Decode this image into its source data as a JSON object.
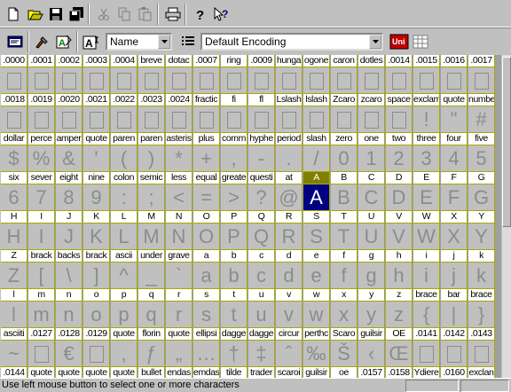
{
  "toolbar": {
    "top_buttons": [
      {
        "name": "new-file-button",
        "icon": "new-document-icon"
      },
      {
        "name": "open-file-button",
        "icon": "open-folder-icon"
      },
      {
        "name": "save-button",
        "icon": "floppy-disk-icon"
      },
      {
        "name": "save-all-button",
        "icon": "multiple-floppy-icon"
      },
      {
        "name": "cut-button",
        "icon": "scissors-icon",
        "disabled": true
      },
      {
        "name": "copy-button",
        "icon": "copy-icon",
        "disabled": true
      },
      {
        "name": "paste-button",
        "icon": "paste-icon",
        "disabled": true
      },
      {
        "name": "print-button",
        "icon": "printer-icon"
      },
      {
        "name": "help-button",
        "icon": "question-mark-icon"
      },
      {
        "name": "context-help-button",
        "icon": "context-help-icon"
      }
    ],
    "view_by_label": "Name",
    "encoding_label": "Default Encoding",
    "unicode_badge": "Uni"
  },
  "grid": {
    "selected": "A",
    "rows": [
      {
        "labels": [
          ".0000",
          ".0001",
          ".0002",
          ".0003",
          ".0004",
          "breve",
          "dotac",
          ".0007",
          "ring",
          ".0009",
          "hunga",
          "ogone",
          "caron",
          "dotles",
          ".0014",
          ".0015",
          ".0016",
          ".0017"
        ],
        "glyphs": [
          "",
          "",
          "",
          "",
          "",
          "",
          "",
          "",
          "",
          "",
          "",
          "",
          "",
          "",
          "",
          "",
          "",
          ""
        ]
      },
      {
        "labels": [
          ".0018",
          ".0019",
          ".0020",
          ".0021",
          ".0022",
          ".0023",
          ".0024",
          "fractic",
          "fi",
          "fl",
          "Lslash",
          "lslash",
          "Zcaro",
          "zcaro",
          "space",
          "exclam",
          "quote",
          "numbe"
        ],
        "glyphs": [
          "",
          "",
          "",
          "",
          "",
          "",
          "",
          "",
          "",
          "",
          "",
          "",
          "",
          "",
          "",
          "!",
          "\"",
          "#"
        ]
      },
      {
        "labels": [
          "dollar",
          "perce",
          "amper",
          "quote",
          "paren",
          "paren",
          "asteris",
          "plus",
          "comm",
          "hyphe",
          "period",
          "slash",
          "zero",
          "one",
          "two",
          "three",
          "four",
          "five"
        ],
        "glyphs": [
          "$",
          "%",
          "&",
          "'",
          "(",
          ")",
          "*",
          "+",
          ",",
          "-",
          ".",
          "/",
          "0",
          "1",
          "2",
          "3",
          "4",
          "5"
        ]
      },
      {
        "labels": [
          "six",
          "sever",
          "eight",
          "nine",
          "colon",
          "semic",
          "less",
          "equal",
          "greate",
          "questi",
          "at",
          "A",
          "B",
          "C",
          "D",
          "E",
          "F",
          "G"
        ],
        "glyphs": [
          "6",
          "7",
          "8",
          "9",
          ":",
          ";",
          "<",
          "=",
          ">",
          "?",
          "@",
          "A",
          "B",
          "C",
          "D",
          "E",
          "F",
          "G"
        ]
      },
      {
        "labels": [
          "H",
          "I",
          "J",
          "K",
          "L",
          "M",
          "N",
          "O",
          "P",
          "Q",
          "R",
          "S",
          "T",
          "U",
          "V",
          "W",
          "X",
          "Y"
        ],
        "glyphs": [
          "H",
          "I",
          "J",
          "K",
          "L",
          "M",
          "N",
          "O",
          "P",
          "Q",
          "R",
          "S",
          "T",
          "U",
          "V",
          "W",
          "X",
          "Y"
        ]
      },
      {
        "labels": [
          "Z",
          "brack",
          "backs",
          "brack",
          "ascii",
          "under",
          "grave",
          "a",
          "b",
          "c",
          "d",
          "e",
          "f",
          "g",
          "h",
          "i",
          "j",
          "k"
        ],
        "glyphs": [
          "Z",
          "[",
          "\\",
          "]",
          "^",
          "_",
          "`",
          "a",
          "b",
          "c",
          "d",
          "e",
          "f",
          "g",
          "h",
          "i",
          "j",
          "k"
        ]
      },
      {
        "labels": [
          "l",
          "m",
          "n",
          "o",
          "p",
          "q",
          "r",
          "s",
          "t",
          "u",
          "v",
          "w",
          "x",
          "y",
          "z",
          "brace",
          "bar",
          "brace"
        ],
        "glyphs": [
          "l",
          "m",
          "n",
          "o",
          "p",
          "q",
          "r",
          "s",
          "t",
          "u",
          "v",
          "w",
          "x",
          "y",
          "z",
          "{",
          "|",
          "}"
        ]
      },
      {
        "labels": [
          "asciiti",
          ".0127",
          ".0128",
          ".0129",
          "quote",
          "florin",
          "quote",
          "ellipsi",
          "dagge",
          "dagge",
          "circur",
          "perthc",
          "Scaro",
          "guilsir",
          "OE",
          ".0141",
          ".0142",
          ".0143"
        ],
        "glyphs": [
          "~",
          "",
          "€",
          "",
          "‚",
          "ƒ",
          "„",
          "…",
          "†",
          "‡",
          "ˆ",
          "‰",
          "Š",
          "‹",
          "Œ",
          "",
          "",
          ""
        ]
      },
      {
        "labels": [
          ".0144",
          "quote",
          "quote",
          "quote",
          "quote",
          "bullet",
          "endas",
          "emdas",
          "tilde",
          "trader",
          "scaroi",
          "guilsir",
          "oe",
          ".0157",
          ".0158",
          "Ydiere",
          ".0160",
          "exclan"
        ],
        "glyphs": [
          "",
          "‘",
          "’",
          "“",
          "”",
          "•",
          "–",
          "—",
          "˜",
          "™",
          "š",
          "›",
          "œ",
          "",
          "",
          "Ÿ",
          "",
          "¡"
        ]
      }
    ]
  },
  "status": {
    "message": "Use left mouse button to select one or more characters"
  }
}
